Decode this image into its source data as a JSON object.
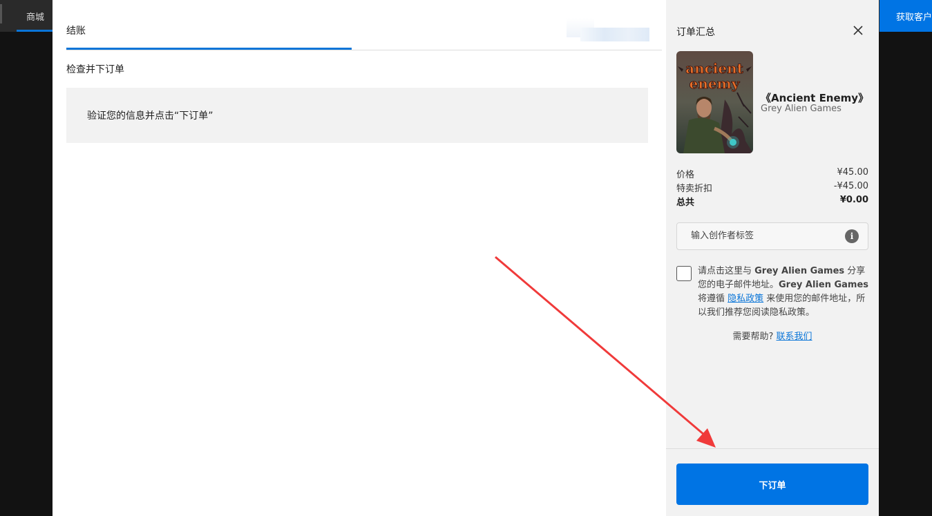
{
  "background": {
    "nav_store": "商城",
    "nav_get_client": "获取客户"
  },
  "checkout": {
    "tab_label": "结账",
    "section_title": "检查并下订单",
    "info_message": "验证您的信息并点击“下订单”"
  },
  "summary": {
    "title": "订单汇总",
    "product": {
      "title": "《Ancient Enemy》",
      "publisher": "Grey Alien Games",
      "cover_text_line1": "ancient",
      "cover_text_line2": "enemy"
    },
    "prices": [
      {
        "label": "价格",
        "value": "¥45.00"
      },
      {
        "label": "特卖折扣",
        "value": "-¥45.00"
      },
      {
        "label": "总共",
        "value": "¥0.00"
      }
    ],
    "creator_tag_placeholder": "输入创作者标签",
    "consent": {
      "part1": "请点击这里与 ",
      "publisher1": "Grey Alien Games",
      "part2": " 分享您的电子邮件地址。",
      "publisher2": "Grey Alien Games",
      "part3": " 将遵循 ",
      "privacy_link": "隐私政策",
      "part4": " 来使用您的邮件地址，所以我们推荐您阅读隐私政策。"
    },
    "help_text": "需要帮助? ",
    "help_link": "联系我们",
    "place_order_label": "下订单"
  },
  "colors": {
    "accent": "#0074e4",
    "annotation_arrow": "#f03a3a"
  }
}
